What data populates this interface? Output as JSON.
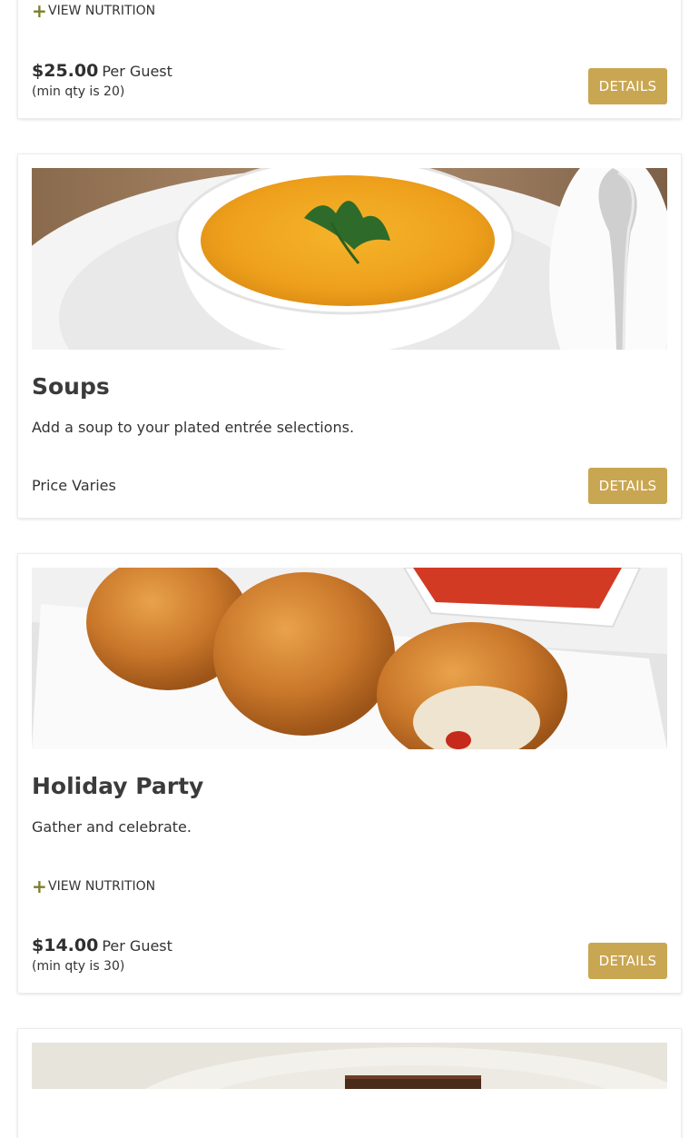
{
  "cards": [
    {
      "nutrition_label": "VIEW NUTRITION",
      "price": "$25.00",
      "per": "Per Guest",
      "min_qty": "(min qty is 20)",
      "details_label": "DETAILS"
    },
    {
      "image": "soup-bowl-photo",
      "title": "Soups",
      "description": "Add a soup to your plated entrée selections.",
      "price_text": "Price Varies",
      "details_label": "DETAILS"
    },
    {
      "image": "fried-rice-balls-photo",
      "title": "Holiday Party",
      "description": "Gather and celebrate.",
      "nutrition_label": "VIEW NUTRITION",
      "price": "$14.00",
      "per": "Per Guest",
      "min_qty": "(min qty is 30)",
      "details_label": "DETAILS"
    },
    {
      "image": "dessert-plate-photo"
    }
  ],
  "icons": {
    "nutrition_toggle": "plus-icon"
  },
  "colors": {
    "details_button": "#c9a651",
    "plus_icon": "#7a7f2c",
    "title_text": "#3b3b3b"
  }
}
